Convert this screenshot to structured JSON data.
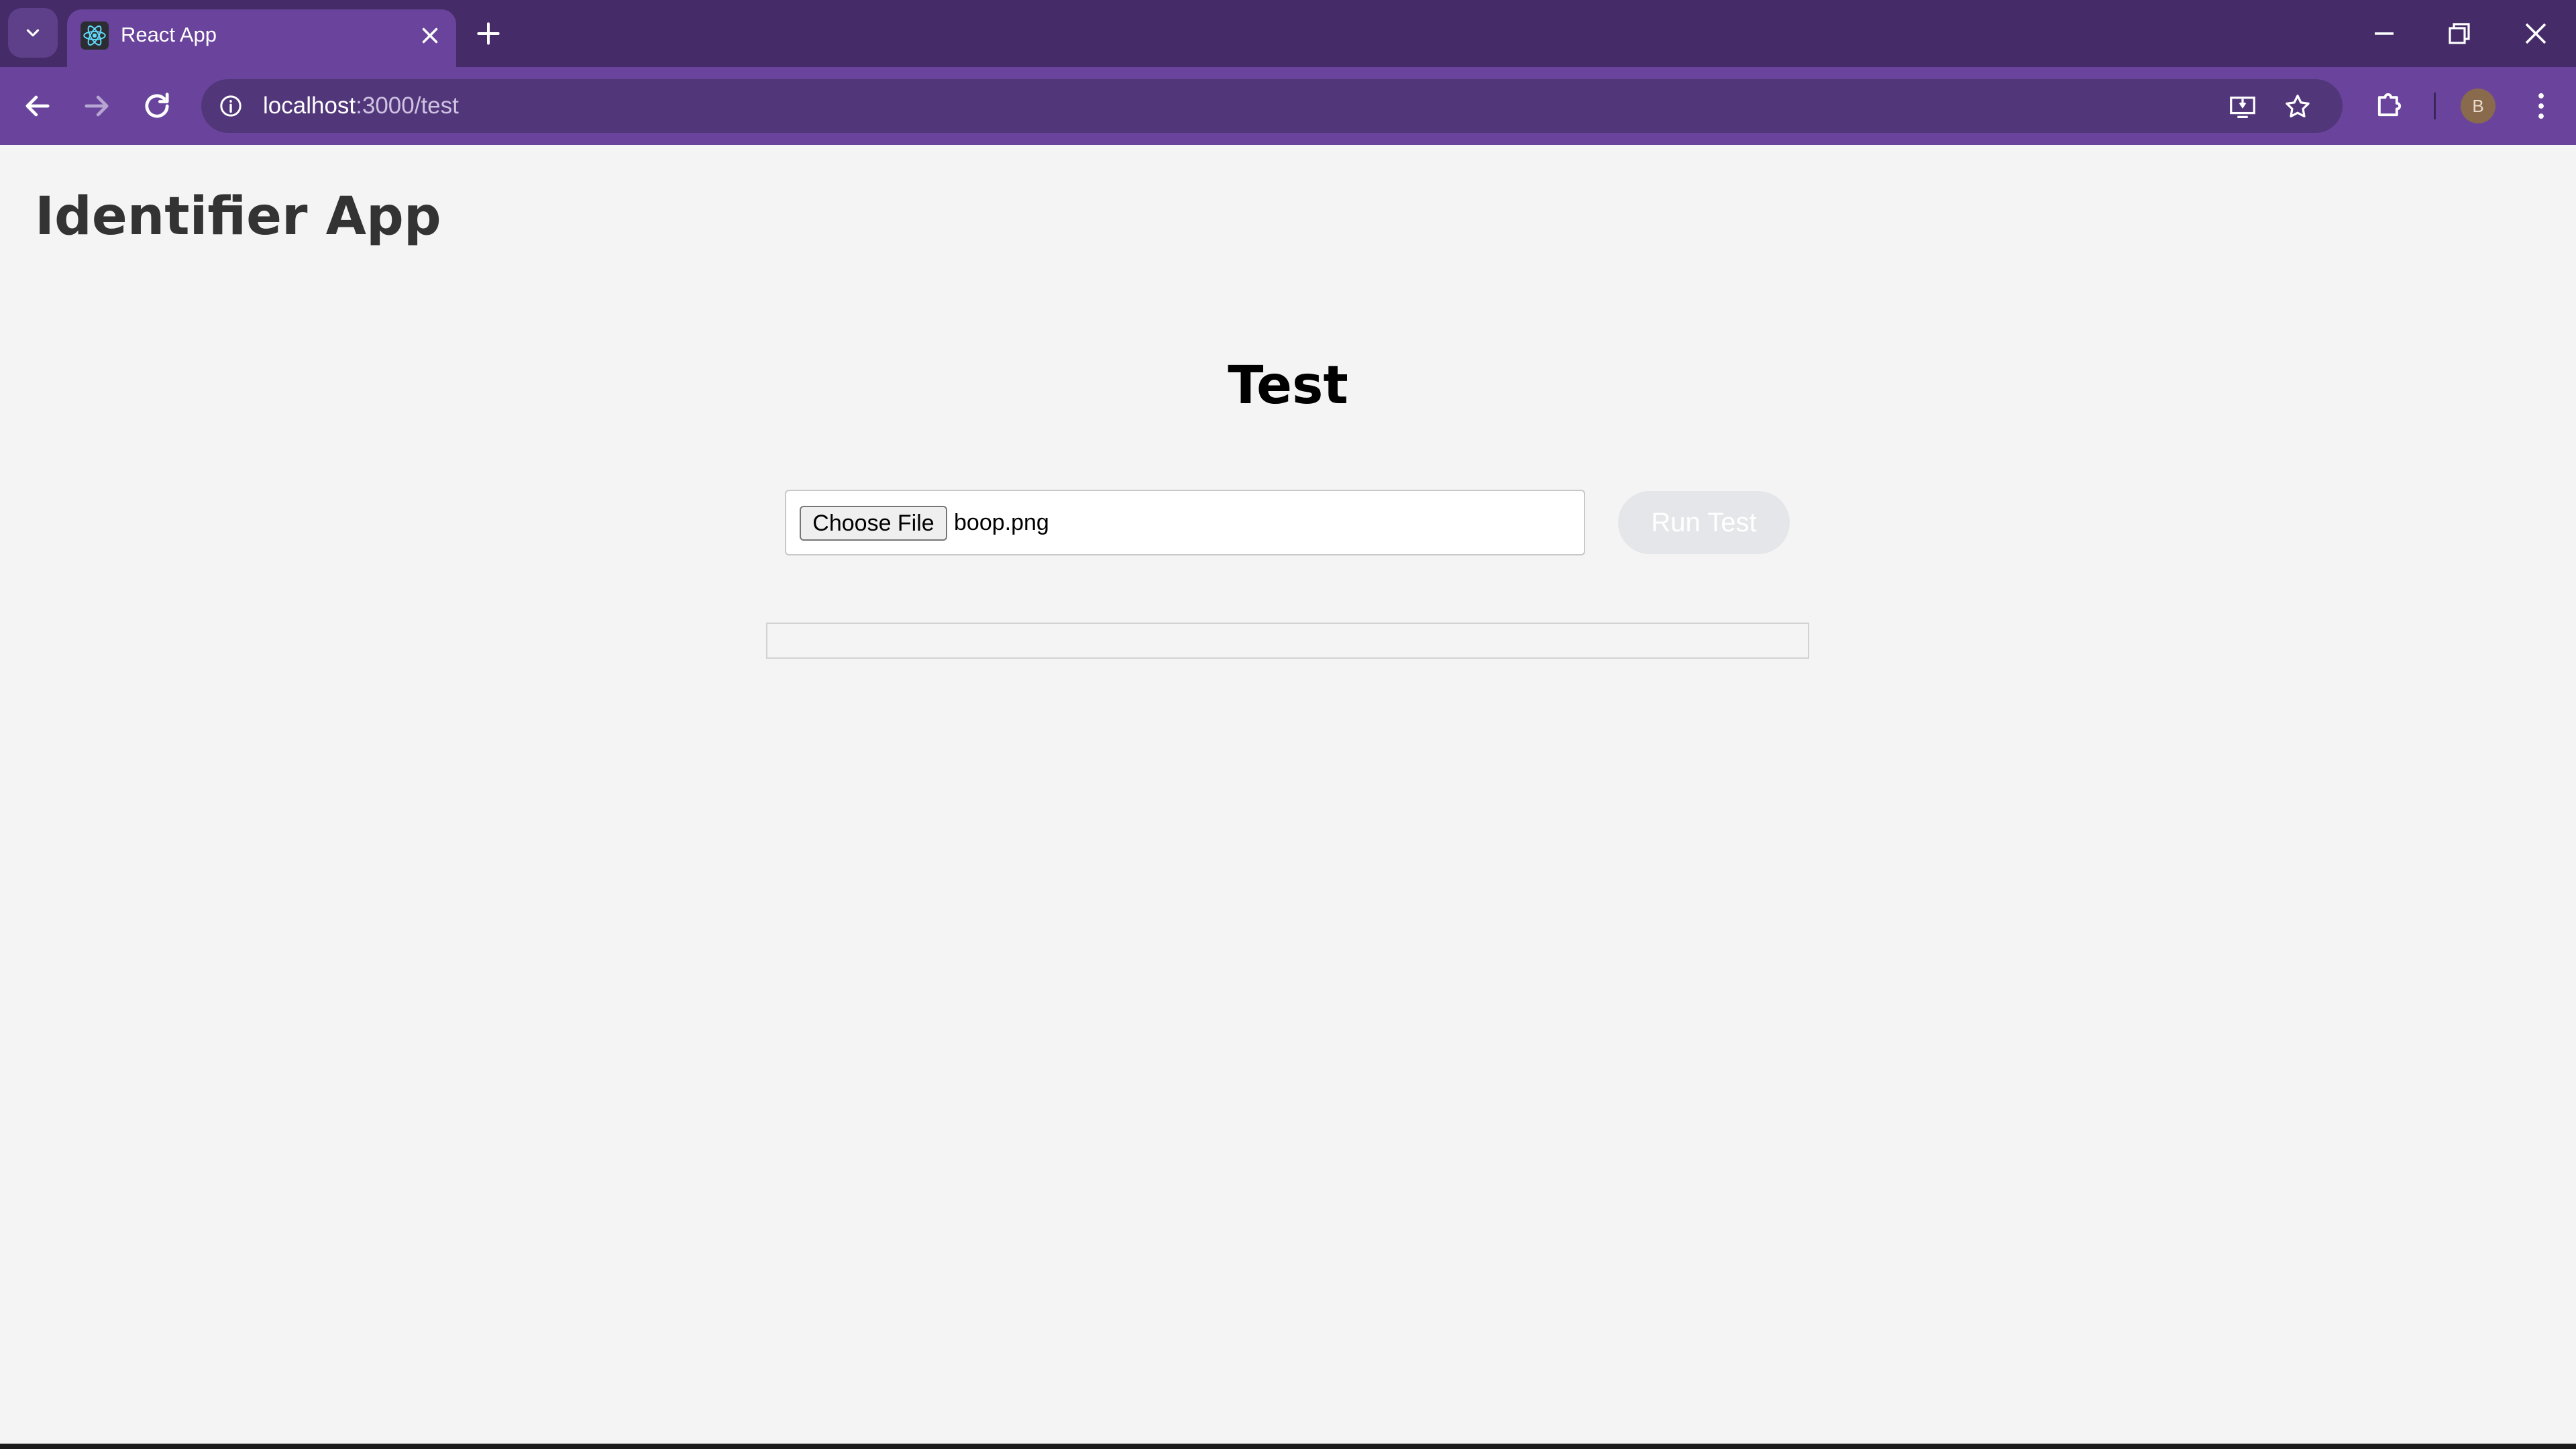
{
  "browser": {
    "tab": {
      "title": "React App",
      "favicon": "react-logo-icon"
    },
    "address": {
      "host": "localhost",
      "path": ":3000/test"
    },
    "profile_initial": "B",
    "colors": {
      "frame": "#452b67",
      "toolbar": "#6a449c",
      "omnibox": "#51367a"
    }
  },
  "app": {
    "title": "Identifier App",
    "section_title": "Test",
    "file_input": {
      "button_label": "Choose File",
      "file_name": "boop.png"
    },
    "run_button": {
      "label": "Run Test",
      "disabled": true
    },
    "result": {
      "text": ""
    }
  }
}
